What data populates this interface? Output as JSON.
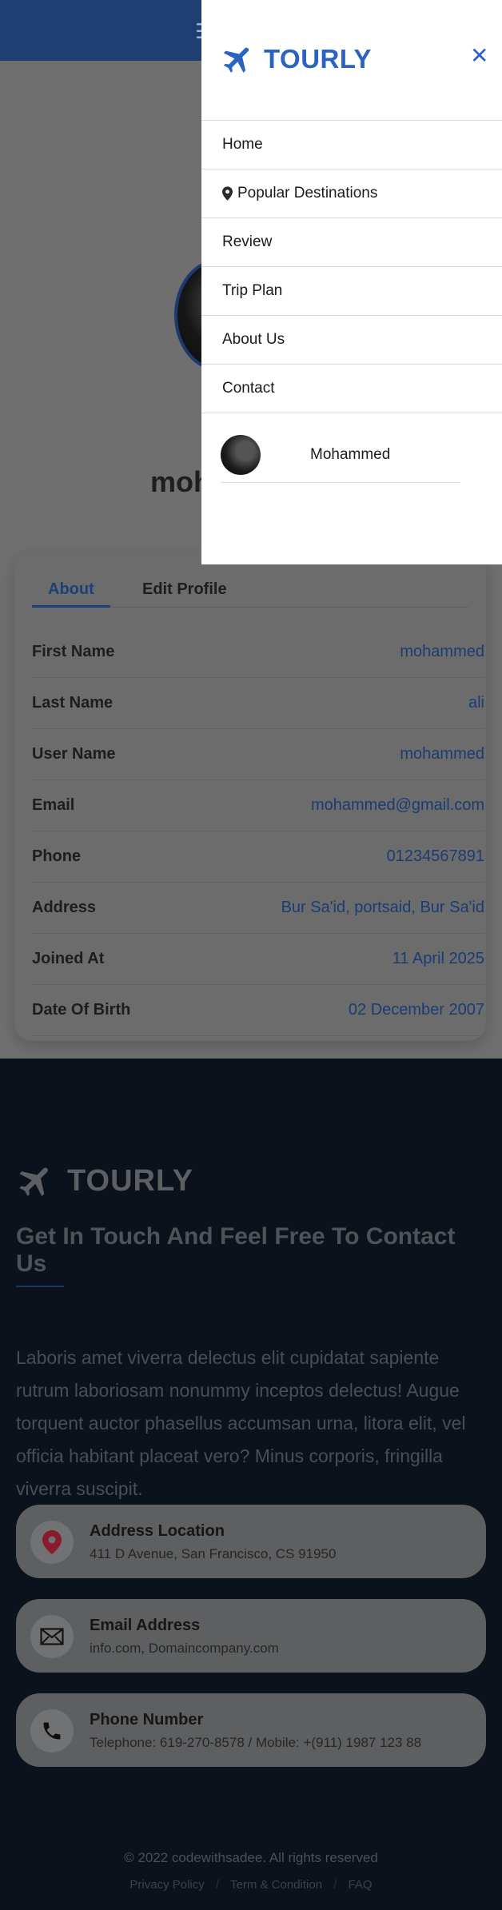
{
  "brand": {
    "name": "TOURLY",
    "accent": "#2b63c2"
  },
  "icons": {
    "menu": "hamburger-icon",
    "close": "close-icon",
    "plane": "plane-icon",
    "pin": "map-pin-icon",
    "email": "envelope-icon",
    "phone": "phone-icon"
  },
  "drawer": {
    "close_label": "✕",
    "menu": [
      {
        "label": "Home"
      },
      {
        "label": "Popular Destinations",
        "icon": "map-pin-icon"
      },
      {
        "label": "Review"
      },
      {
        "label": "Trip Plan"
      },
      {
        "label": "About Us"
      },
      {
        "label": "Contact"
      }
    ],
    "user_name": "Mohammed"
  },
  "profile": {
    "name_visible": "moh",
    "tabs": [
      {
        "label": "About",
        "active": true
      },
      {
        "label": "Edit Profile",
        "active": false
      }
    ],
    "fields": [
      {
        "label": "First Name",
        "value": "mohammed"
      },
      {
        "label": "Last Name",
        "value": "ali"
      },
      {
        "label": "User Name",
        "value": "mohammed"
      },
      {
        "label": "Email",
        "value": "mohammed@gmail.com"
      },
      {
        "label": "Phone",
        "value": "01234567891"
      },
      {
        "label": "Address",
        "value": "Bur Sa'id, portsaid, Bur Sa'id"
      },
      {
        "label": "Joined At",
        "value": "11 April 2025"
      },
      {
        "label": "Date Of Birth",
        "value": "02 December 2007"
      }
    ]
  },
  "footer": {
    "heading": "Get In Touch And Feel Free To Contact Us",
    "paragraph": "Laboris amet viverra delectus elit cupidatat sapiente rutrum laboriosam nonummy inceptos delectus! Augue torquent auctor phasellus accumsan urna, litora elit, vel officia habitant placeat vero? Minus corporis, fringilla viverra suscipit.",
    "contacts": [
      {
        "title": "Address Location",
        "text": "411 D Avenue, San Francisco, CS 91950",
        "icon": "map-pin-icon"
      },
      {
        "title": "Email Address",
        "text": "info.com, Domaincompany.com",
        "icon": "envelope-icon"
      },
      {
        "title": "Phone Number",
        "text": "Telephone: 619-270-8578 / Mobile: +(911) 1987 123 88",
        "icon": "phone-icon"
      }
    ],
    "copyright": "© 2022 codewithsadee. All rights reserved",
    "links": [
      "Privacy Policy",
      "Term & Condition",
      "FAQ"
    ],
    "link_separator": "/"
  }
}
